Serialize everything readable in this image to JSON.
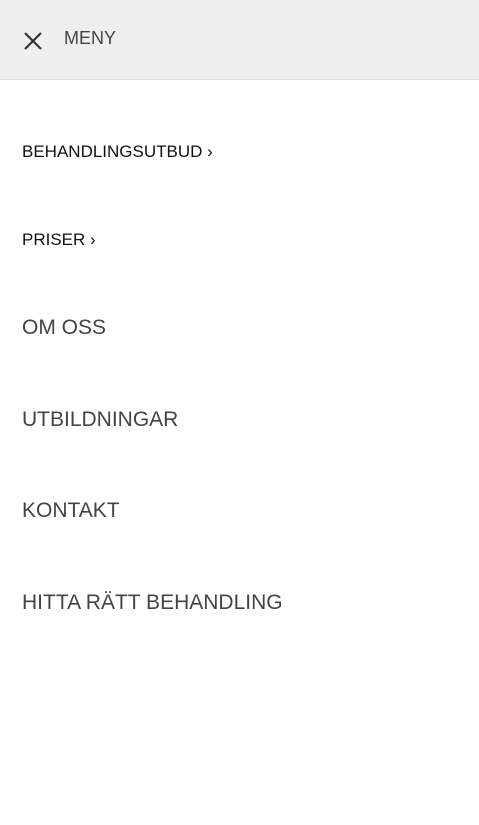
{
  "header": {
    "title": "MENY",
    "close_icon": "close-icon"
  },
  "menu": {
    "items": [
      {
        "label": "BEHANDLINGSUTBUD ›"
      },
      {
        "label": "PRISER ›"
      },
      {
        "label": "OM OSS"
      },
      {
        "label": "UTBILDNINGAR"
      },
      {
        "label": "KONTAKT"
      },
      {
        "label": "HITTA RÄTT BEHANDLING"
      }
    ]
  }
}
